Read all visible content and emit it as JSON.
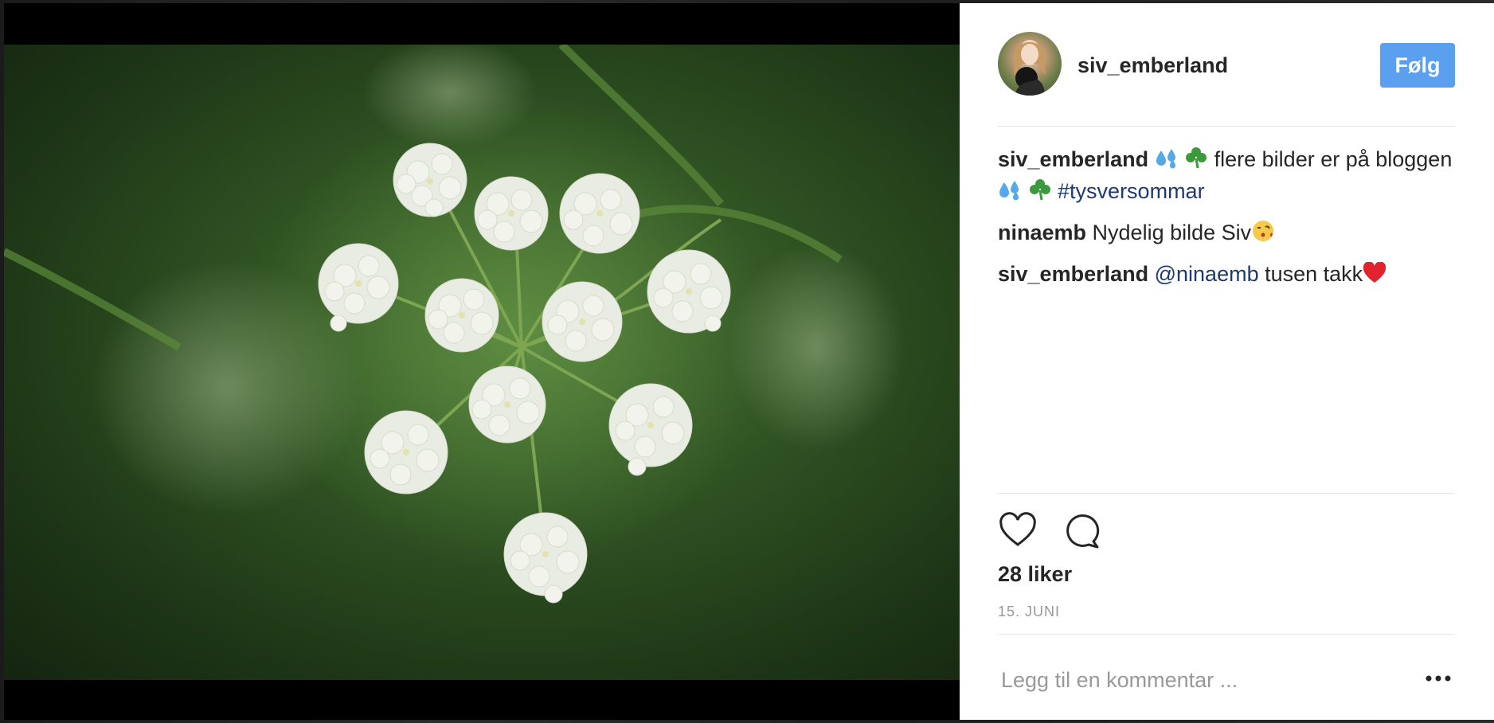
{
  "post": {
    "username": "siv_emberland",
    "follow_label": "Følg",
    "likes_text": "28 liker",
    "date": "15. JUNI"
  },
  "comments": [
    {
      "user": "siv_emberland",
      "parts": [
        "flere bilder er på bloggen",
        "#tysversommar"
      ]
    },
    {
      "user": "ninaemb",
      "text": "Nydelig bilde Siv"
    },
    {
      "user": "siv_emberland",
      "mention": "@ninaemb",
      "text": "tusen takk"
    }
  ],
  "comment_input": {
    "placeholder": "Legg til en kommentar ..."
  },
  "colors": {
    "follow_button": "#5b9ff0",
    "hashtag": "#1e3a6e",
    "text": "#262626",
    "muted": "#999999"
  },
  "icons": [
    "heart-icon",
    "comment-bubble-icon",
    "more-options-icon",
    "droplets-emoji",
    "shamrock-emoji",
    "kiss-emoji",
    "red-heart-emoji"
  ]
}
